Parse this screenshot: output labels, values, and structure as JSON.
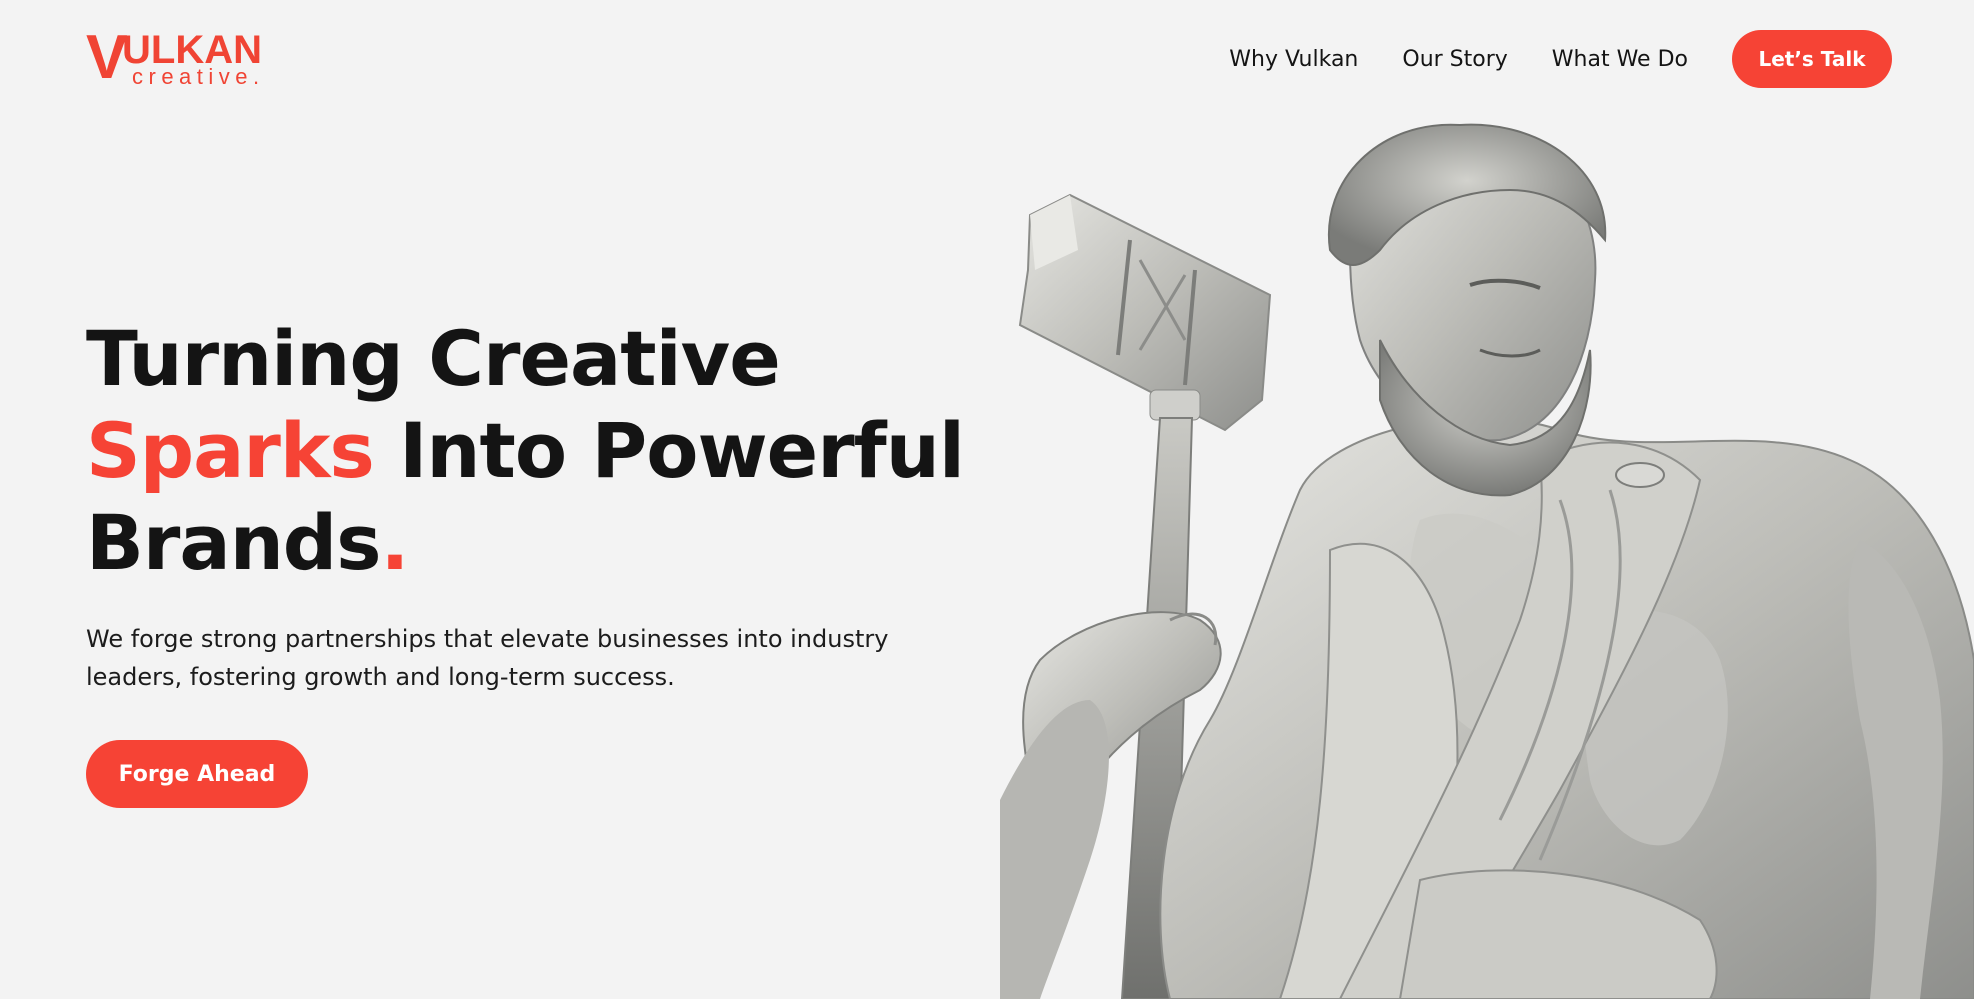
{
  "brand": {
    "logo_mark": "V",
    "logo_word": "ULKAN",
    "logo_sub": "creative."
  },
  "nav": {
    "items": [
      {
        "label": "Why Vulkan"
      },
      {
        "label": "Our Story"
      },
      {
        "label": "What We Do"
      }
    ],
    "cta_label": "Let’s Talk"
  },
  "hero": {
    "title_line1": "Turning Creative",
    "title_accent": "Sparks",
    "title_line2_rest": " Into Powerful",
    "title_line3": "Brands",
    "title_period": ".",
    "subtitle": "We forge strong partnerships that elevate businesses into industry leaders, fostering growth and long-term success.",
    "cta_label": "Forge Ahead"
  },
  "colors": {
    "accent": "#f64335",
    "background": "#f3f3f3",
    "text": "#141414"
  },
  "image": {
    "subject": "marble-statue-with-hammer"
  }
}
